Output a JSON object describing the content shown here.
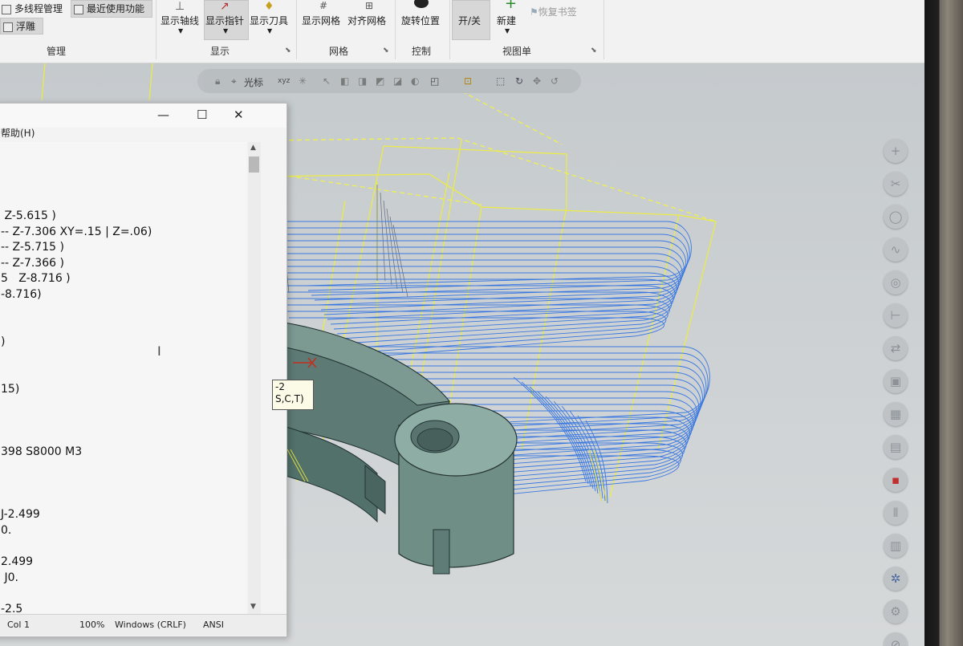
{
  "ribbon": {
    "multi_thread": "多线程管理",
    "recent_functions": "最近使用功能",
    "float": "浮雕",
    "show_axis": "显示轴线",
    "show_pointer": "显示指针",
    "show_tool": "显示刀具",
    "show_grid": "显示网格",
    "align_grid": "对齐网格",
    "rotate_position": "旋转位置",
    "on_off": "开/关",
    "new": "新建",
    "restore_bookmark": "恢复书签",
    "groups": {
      "manage": "管理",
      "display": "显示",
      "grid": "网格",
      "control": "控制",
      "view_sheet": "视图单"
    }
  },
  "viewport_toolbar": {
    "cursor_label": "光标",
    "xyz": "xyz"
  },
  "right_toolbar": {
    "icons": [
      "plus-icon",
      "cut-icon",
      "circle-icon",
      "curve-icon",
      "target-icon",
      "dimension-icon",
      "swap-icon",
      "cube-icon",
      "box-icon",
      "stack-icon",
      "red-box-icon",
      "bars-icon",
      "chart-icon",
      "gear-cluster-icon",
      "gear-icon",
      "no-icon"
    ]
  },
  "notepad": {
    "title_controls": {
      "minimize": "—",
      "maximize": "☐",
      "close": "✕"
    },
    "menu_help": "帮助(H)",
    "lines": [
      " Z-5.615 )",
      "-- Z-7.306 XY=.15 | Z=.06)",
      "-- Z-5.715 )",
      "-- Z-7.366 )",
      "5   Z-8.716 )",
      "-8.716)",
      "",
      "",
      ")",
      "",
      "",
      "15)",
      "",
      "",
      "",
      "398 S8000 M3",
      "",
      "",
      "",
      "J-2.499",
      "0.",
      "",
      "2.499",
      " J0.",
      "",
      "-2.5"
    ],
    "status": {
      "position": "Col 1",
      "zoom": "100%",
      "line_ending": "Windows (CRLF)",
      "encoding": "ANSI"
    }
  },
  "tooltip": {
    "line1": "-2",
    "line2": "S,C,T)"
  }
}
